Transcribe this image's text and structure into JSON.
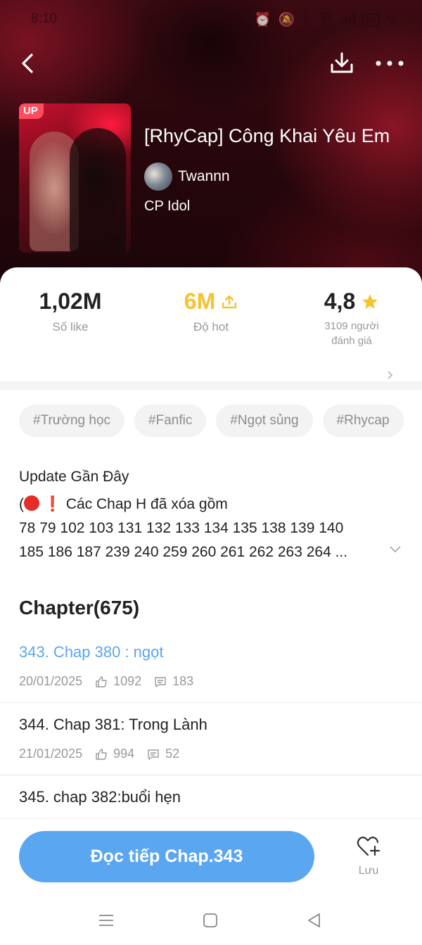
{
  "status_bar": {
    "time": "8:10",
    "battery": "96"
  },
  "book": {
    "badge": "UP",
    "title": "[RhyCap] Công Khai Yêu Em",
    "author": "Twannn",
    "category": "CP Idol"
  },
  "stats": {
    "likes": {
      "value": "1,02M",
      "label": "Số like"
    },
    "hot": {
      "value": "6M",
      "label": "Độ hot"
    },
    "rating": {
      "value": "4,8",
      "label_line1": "3109 người",
      "label_line2": "đánh giá"
    }
  },
  "tags": [
    "#Trường học",
    "#Fanfic",
    "#Ngọt sủng",
    "#Rhycap"
  ],
  "update": {
    "title": "Update Gần Đây",
    "line1_prefix": "(",
    "line1_excl": "❗",
    "line1_text": " Các Chap H đã xóa gồm",
    "line2": "78 79 102 103 131 132 133 134 135 138 139 140",
    "line3": "185 186 187 239 240 259 260 261 262 263 264 ..."
  },
  "chapters_heading": "Chapter(675)",
  "chapters": [
    {
      "title": "343. Chap 380 : ngọt",
      "date": "20/01/2025",
      "likes": "1092",
      "comments": "183",
      "current": true
    },
    {
      "title": "344. Chap 381: Trong Lành",
      "date": "21/01/2025",
      "likes": "994",
      "comments": "52",
      "current": false
    },
    {
      "title": "345. chap 382:buổi hẹn",
      "date": "",
      "likes": "",
      "comments": "",
      "current": false
    }
  ],
  "actions": {
    "continue_label": "Đọc tiếp Chap.343",
    "save_label": "Lưu"
  },
  "colors": {
    "accent": "#5aa6f0",
    "hot": "#f7c22e",
    "star": "#f7c22e",
    "badge": "#ff4d5e"
  },
  "icons": [
    "back-icon",
    "download-icon",
    "more-icon",
    "upload-icon",
    "star-icon",
    "chevron-right-icon",
    "chevron-down-icon",
    "thumb-up-icon",
    "comment-icon",
    "heart-plus-icon",
    "menu-icon",
    "home-square-icon",
    "back-triangle-icon"
  ]
}
